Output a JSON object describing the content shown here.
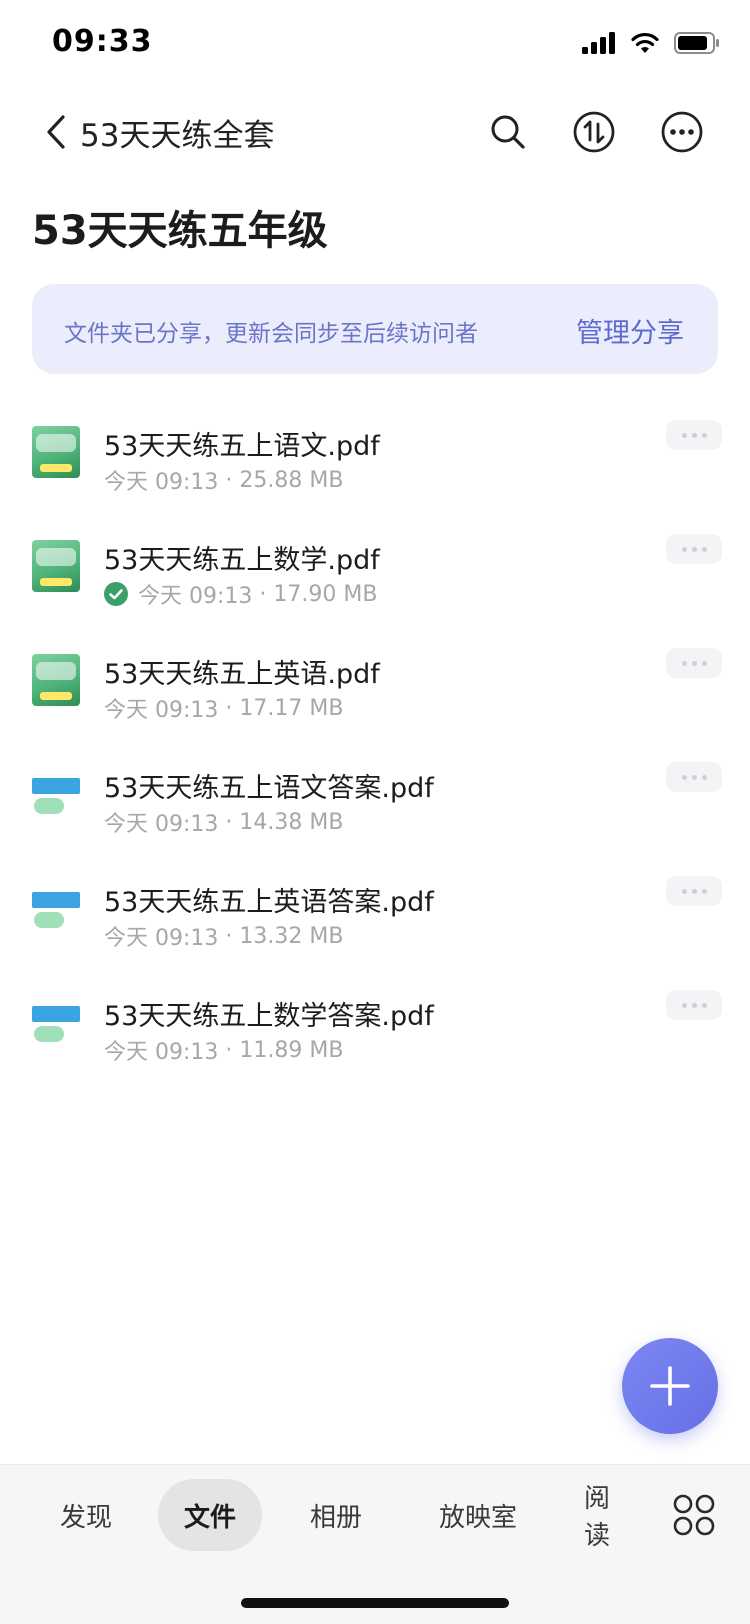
{
  "status_bar": {
    "time": "09:33"
  },
  "nav": {
    "title": "53天天练全套"
  },
  "page_title": "53天天练五年级",
  "share_banner": {
    "message": "文件夹已分享，更新会同步至后续访问者",
    "action": "管理分享"
  },
  "files": [
    {
      "name": "53天天练五上语文.pdf",
      "date": "今天 09:13",
      "size": "25.88 MB",
      "thumb": "cover",
      "synced": false
    },
    {
      "name": "53天天练五上数学.pdf",
      "date": "今天 09:13",
      "size": "17.90 MB",
      "thumb": "cover",
      "synced": true
    },
    {
      "name": "53天天练五上英语.pdf",
      "date": "今天 09:13",
      "size": "17.17 MB",
      "thumb": "cover",
      "synced": false
    },
    {
      "name": "53天天练五上语文答案.pdf",
      "date": "今天 09:13",
      "size": "14.38 MB",
      "thumb": "answer",
      "synced": false
    },
    {
      "name": "53天天练五上英语答案.pdf",
      "date": "今天 09:13",
      "size": "13.32 MB",
      "thumb": "answer",
      "synced": false
    },
    {
      "name": "53天天练五上数学答案.pdf",
      "date": "今天 09:13",
      "size": "11.89 MB",
      "thumb": "answer",
      "synced": false
    }
  ],
  "tabs": {
    "discover": "发现",
    "files": "文件",
    "album": "相册",
    "cinema": "放映室",
    "read": "阅读"
  },
  "colors": {
    "accent": "#6670e6",
    "banner_bg": "#ecedfc",
    "synced": "#3aa06a"
  },
  "icons": [
    "back-icon",
    "search-icon",
    "sort-icon",
    "more-icon",
    "more-dots-icon",
    "check-circle-icon",
    "plus-icon",
    "apps-grid-icon"
  ]
}
